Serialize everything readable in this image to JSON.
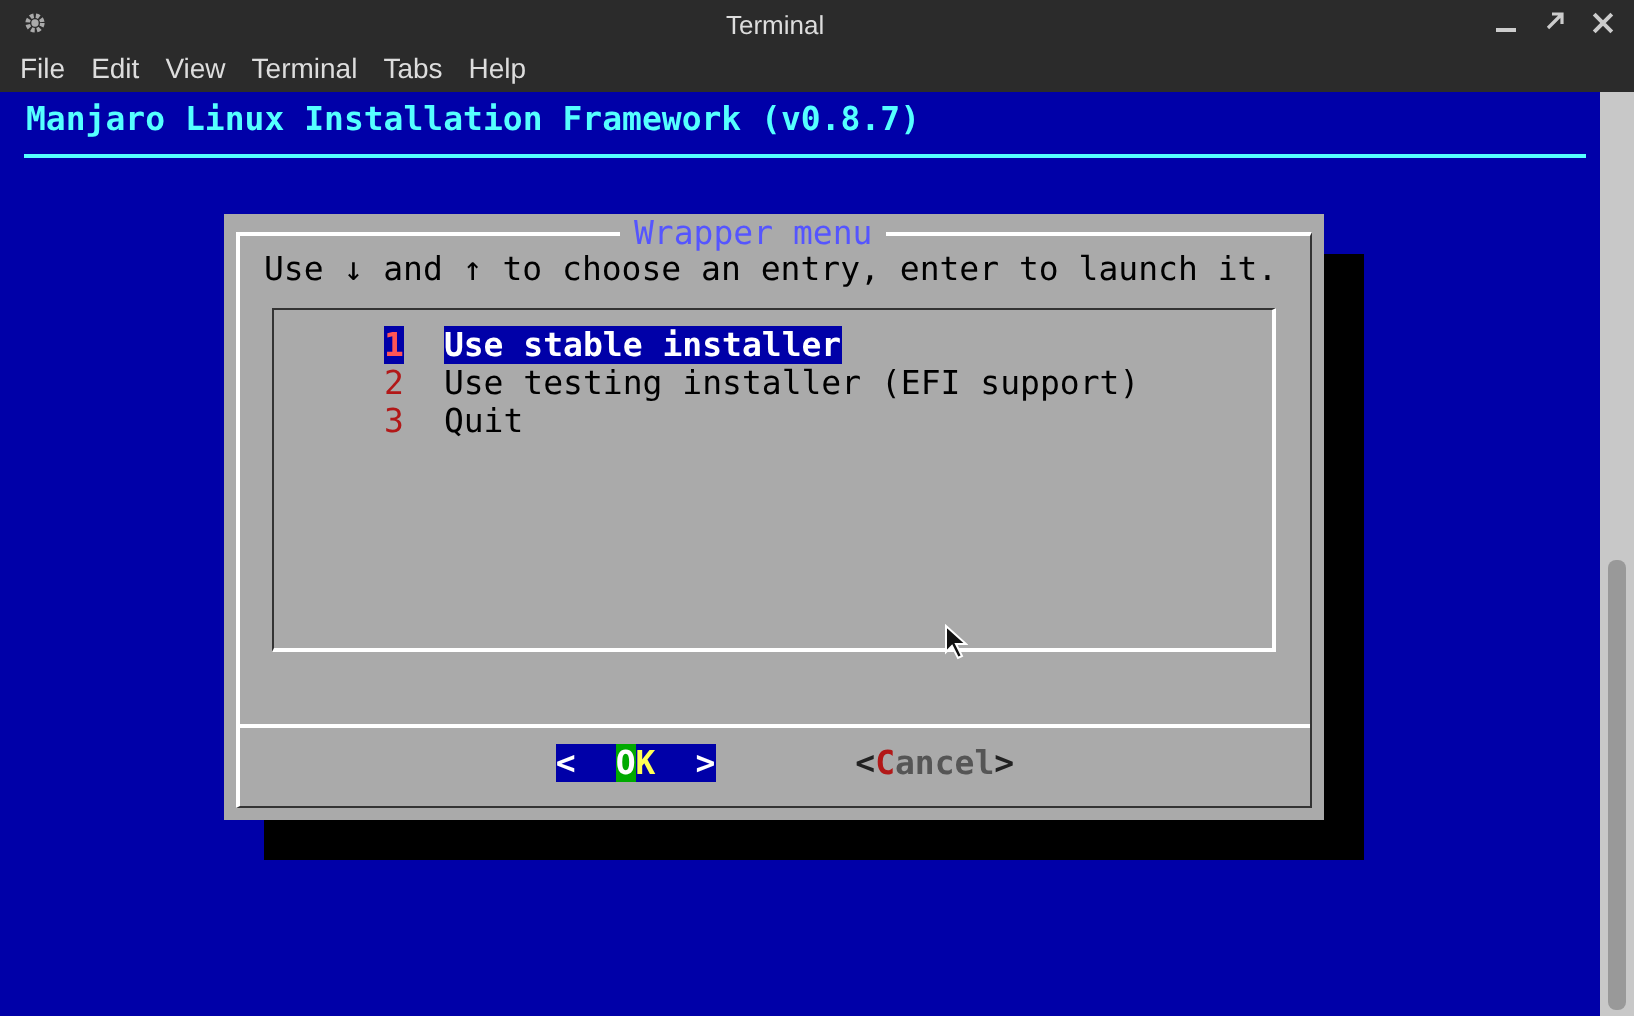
{
  "window": {
    "title": "Terminal"
  },
  "menu": [
    "File",
    "Edit",
    "View",
    "Terminal",
    "Tabs",
    "Help"
  ],
  "terminal": {
    "header": "Manjaro Linux Installation Framework (v0.8.7)",
    "dialog": {
      "title": "Wrapper menu",
      "prompt": "Use ↓ and ↑ to choose an entry, enter to launch it.",
      "items": [
        {
          "key": "1",
          "label": "Use stable installer",
          "selected": true
        },
        {
          "key": "2",
          "label": "Use testing installer (EFI support)",
          "selected": false
        },
        {
          "key": "3",
          "label": "Quit",
          "selected": false
        }
      ],
      "buttons": [
        {
          "open": "<",
          "label": "OK",
          "close": ">",
          "selected": true
        },
        {
          "open": "<",
          "label": "Cancel",
          "close": ">",
          "selected": false
        }
      ]
    }
  }
}
